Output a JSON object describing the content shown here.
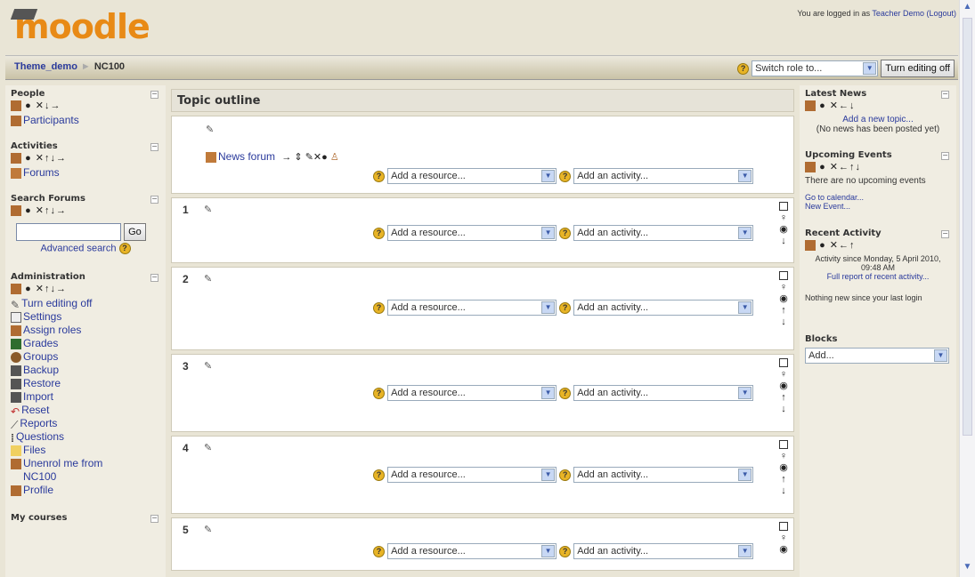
{
  "header": {
    "logo": "moodle",
    "login_prefix": "You are logged in as ",
    "login_user": "Teacher Demo",
    "logout": "(Logout)"
  },
  "navbar": {
    "crumbs": [
      "Theme_demo",
      "NC100"
    ],
    "switch_role": "Switch role to...",
    "turn_editing_off": "Turn editing off"
  },
  "left": {
    "people": {
      "title": "People",
      "items": [
        "Participants"
      ]
    },
    "activities": {
      "title": "Activities",
      "items": [
        "Forums"
      ]
    },
    "search": {
      "title": "Search Forums",
      "go": "Go",
      "advanced": "Advanced search"
    },
    "admin": {
      "title": "Administration",
      "items": [
        "Turn editing off",
        "Settings",
        "Assign roles",
        "Grades",
        "Groups",
        "Backup",
        "Restore",
        "Import",
        "Reset",
        "Reports",
        "Questions",
        "Files",
        "Unenrol me from NC100",
        "Profile"
      ]
    },
    "mycourses": {
      "title": "My courses"
    }
  },
  "main": {
    "title": "Topic outline",
    "forum": "News forum",
    "add_resource": "Add a resource...",
    "add_activity": "Add an activity...",
    "sections": [
      "1",
      "2",
      "3",
      "4",
      "5"
    ]
  },
  "right": {
    "news": {
      "title": "Latest News",
      "add": "Add a new topic...",
      "none": "(No news has been posted yet)"
    },
    "events": {
      "title": "Upcoming Events",
      "none": "There are no upcoming events",
      "calendar": "Go to calendar...",
      "new": "New Event..."
    },
    "recent": {
      "title": "Recent Activity",
      "since": "Activity since Monday, 5 April 2010, 09:48 AM",
      "full": "Full report of recent activity...",
      "nothing": "Nothing new since your last login"
    },
    "blocks": {
      "title": "Blocks",
      "add": "Add..."
    }
  },
  "colors": {
    "accent": "#e88a16",
    "link": "#2a3a9c",
    "help": "#e8b426"
  }
}
